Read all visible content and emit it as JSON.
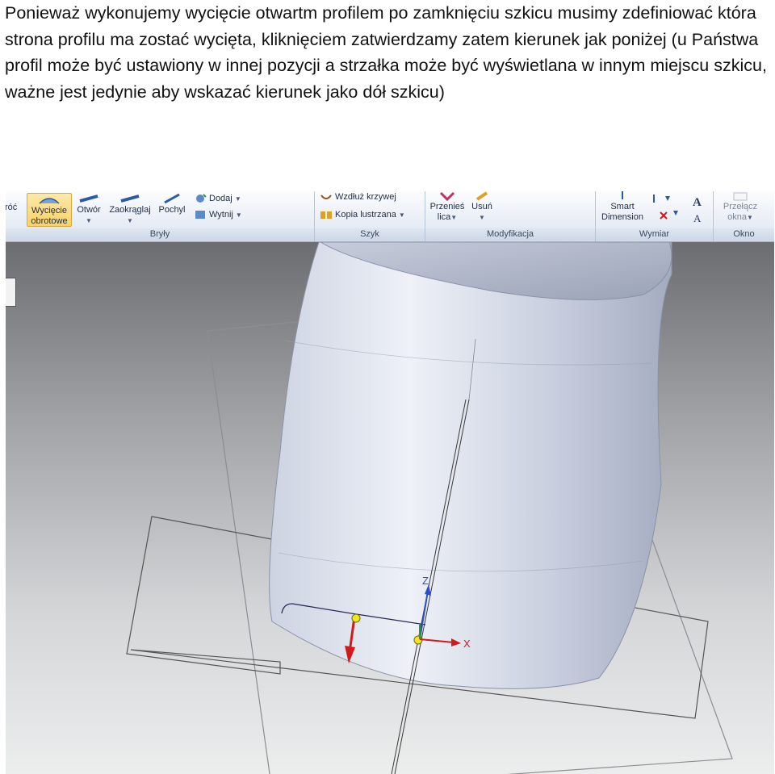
{
  "instruction_text": "Ponieważ wykonujemy wycięcie otwartm profilem po zamknięciu szkicu musimy zdefiniować która strona profilu ma zostać wycięta, kliknięciem zatwierdzamy zatem kierunek jak poniżej (u Państwa profil może być ustawiony w innej pozycji a strzałka może być wyświetlana w innym miejscu szkicu, ważne jest jedynie aby wskazać kierunek jako dół szkicu)",
  "ribbon": {
    "cut_off_label": "róć",
    "bryly": {
      "group_label": "Bryły",
      "wyciecie_line1": "Wycięcie",
      "wyciecie_line2": "obrotowe",
      "otwor": "Otwór",
      "zaokraglaj": "Zaokrąglaj",
      "pochyl": "Pochyl",
      "dodaj": "Dodaj",
      "wytnij": "Wytnij"
    },
    "szyk": {
      "group_label": "Szyk",
      "wzdluz_krzywej": "Wzdłuż krzywej",
      "kopia_lustrzana": "Kopia lustrzana"
    },
    "modyfikacja": {
      "group_label": "Modyfikacja",
      "przenies_line1": "Przenieś",
      "przenies_line2": "lica",
      "usun": "Usuń"
    },
    "wymiar": {
      "group_label": "Wymiar",
      "smart_line1": "Smart",
      "smart_line2": "Dimension"
    },
    "okno": {
      "group_label": "Okno",
      "przelacz_line1": "Przełącz",
      "przelacz_line2": "okna"
    }
  },
  "viewport": {
    "axis_x_label": "X",
    "axis_z_label": "Z",
    "colors": {
      "cylinder_light": "#dfe4ef",
      "cylinder_dark": "#a9b0c3",
      "direction_arrow": "#d21a1a",
      "axis_blue": "#2a4fd0",
      "sketch_point": "#f5e61a"
    },
    "icons": [
      "cut-direction-arrow",
      "coordinate-triad",
      "sketch-point"
    ]
  }
}
